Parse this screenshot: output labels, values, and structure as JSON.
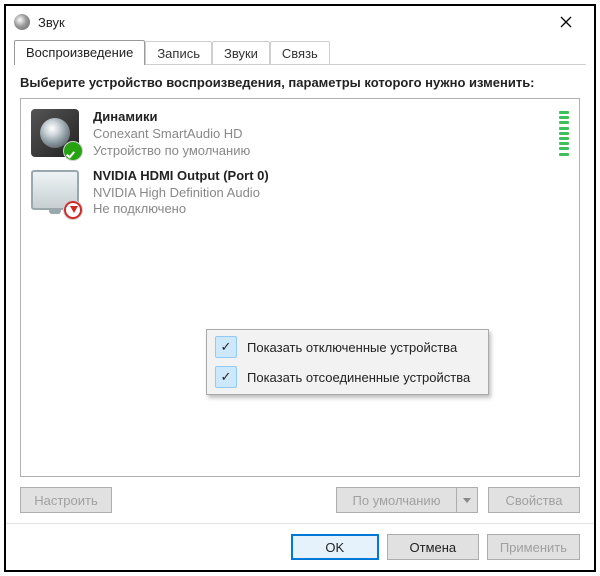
{
  "titlebar": {
    "text": "Звук"
  },
  "tabs": [
    {
      "label": "Воспроизведение",
      "selected": true
    },
    {
      "label": "Запись"
    },
    {
      "label": "Звуки"
    },
    {
      "label": "Связь"
    }
  ],
  "instruction": "Выберите устройство воспроизведения, параметры которого нужно изменить:",
  "devices": [
    {
      "name": "Динамики",
      "subtitle": "Conexant SmartAudio HD",
      "status": "Устройство по умолчанию",
      "icon": "speaker",
      "badge": "check",
      "meter": true
    },
    {
      "name": "NVIDIA HDMI Output (Port 0)",
      "subtitle": "NVIDIA High Definition Audio",
      "status": "Не подключено",
      "icon": "monitor",
      "badge": "down",
      "meter": false
    }
  ],
  "context_menu": [
    {
      "label": "Показать отключенные устройства",
      "checked": true
    },
    {
      "label": "Показать отсоединенные устройства",
      "checked": true
    }
  ],
  "panel_buttons": {
    "configure": "Настроить",
    "set_default": "По умолчанию",
    "properties": "Свойства"
  },
  "footer_buttons": {
    "ok": "OK",
    "cancel": "Отмена",
    "apply": "Применить"
  }
}
